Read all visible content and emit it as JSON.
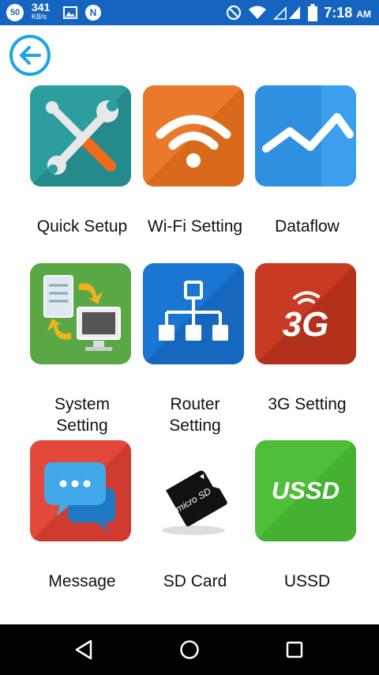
{
  "status_bar": {
    "badge": "50",
    "speed_value": "341",
    "speed_unit": "KB/s",
    "notification_letter": "N",
    "time": "7:18",
    "ampm": "AM",
    "icons": [
      "blocked-icon",
      "wifi-icon",
      "signal-icon",
      "battery-icon"
    ]
  },
  "header": {
    "back_icon": "back-arrow-icon"
  },
  "grid": {
    "items": [
      {
        "label": "Quick Setup",
        "icon": "tools-icon",
        "color": "#2c9ea0"
      },
      {
        "label": "Wi-Fi Setting",
        "icon": "wifi-icon",
        "color": "#ea7a2a"
      },
      {
        "label": "Dataflow",
        "icon": "line-chart-icon",
        "color": "#2f8fe0"
      },
      {
        "label_line1": "System",
        "label_line2": "Setting",
        "icon": "system-setting-icon",
        "color": "#5aa845"
      },
      {
        "label_line1": "Router",
        "label_line2": "Setting",
        "icon": "network-icon",
        "color": "#1976d2"
      },
      {
        "label": "3G Setting",
        "icon_text": "3G",
        "icon": "3g-icon",
        "color": "#c83b22"
      },
      {
        "label": "Message",
        "icon": "chat-icon",
        "color": "#e2493b"
      },
      {
        "label": "SD Card",
        "icon_text": "micro SD",
        "icon": "sd-card-icon",
        "color": "#ffffff"
      },
      {
        "label": "USSD",
        "icon_text": "USSD",
        "icon": "ussd-icon",
        "color": "#4fbf3a"
      }
    ]
  },
  "nav_bar": {
    "buttons": [
      "back-nav-icon",
      "home-nav-icon",
      "recents-nav-icon"
    ]
  }
}
